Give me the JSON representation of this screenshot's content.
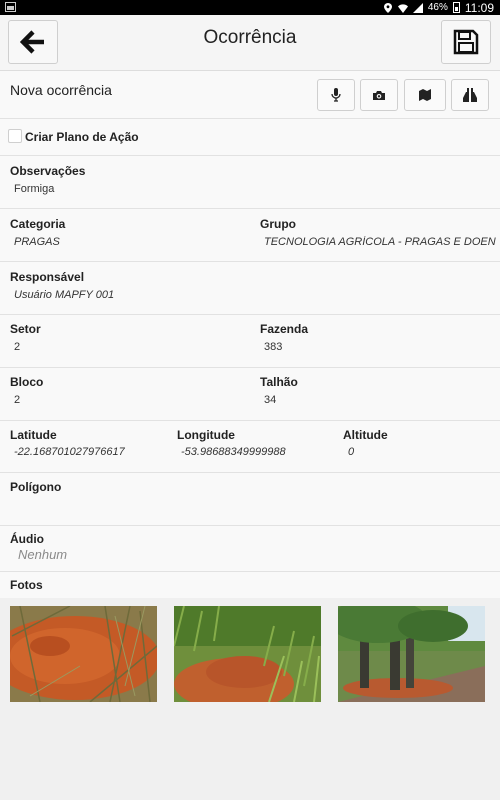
{
  "status_bar": {
    "battery": "46%",
    "time": "11:09"
  },
  "header": {
    "title": "Ocorrência"
  },
  "toolbar": {
    "label": "Nova ocorrência"
  },
  "action_plan": {
    "label": "Criar Plano de Ação"
  },
  "observations": {
    "label": "Observações",
    "value": "Formiga"
  },
  "category": {
    "label": "Categoria",
    "value": "PRAGAS"
  },
  "group": {
    "label": "Grupo",
    "value": "TECNOLOGIA AGRÍCOLA - PRAGAS E DOEN"
  },
  "responsible": {
    "label": "Responsável",
    "value": "Usuário MAPFY 001"
  },
  "sector": {
    "label": "Setor",
    "value": "2"
  },
  "farm": {
    "label": "Fazenda",
    "value": "383"
  },
  "block": {
    "label": "Bloco",
    "value": "2"
  },
  "plot": {
    "label": "Talhão",
    "value": "34"
  },
  "latitude": {
    "label": "Latitude",
    "value": "-22.168701027976617"
  },
  "longitude": {
    "label": "Longitude",
    "value": "-53.98688349999988"
  },
  "altitude": {
    "label": "Altitude",
    "value": "0"
  },
  "polygon": {
    "label": "Polígono",
    "value": ""
  },
  "audio": {
    "label": "Áudio",
    "value": "Nenhum"
  },
  "photos": {
    "label": "Fotos"
  },
  "icons": [
    "back-arrow-icon",
    "save-icon",
    "microphone-icon",
    "camera-icon",
    "map-icon",
    "binoculars-icon"
  ],
  "colors": {
    "appbar": "#f5f5f5",
    "row": "#f9f9f9",
    "statusbar": "#000000"
  }
}
